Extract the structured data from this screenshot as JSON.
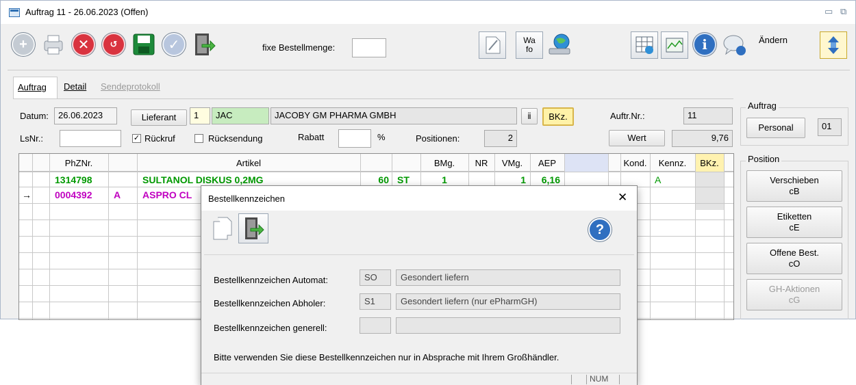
{
  "window": {
    "title": "Auftrag 11 - 26.06.2023 (Offen)",
    "minimize_glyph": "▭",
    "restore_glyph": "⧉"
  },
  "toolbar": {
    "fixe_bestellmenge_label": "fixe Bestellmenge:",
    "fixe_bestellmenge_value": "",
    "wafo_line1": "Wa",
    "wafo_line2": "fo",
    "aendern_label": "Ändern"
  },
  "tabs": [
    {
      "label": "Auftrag",
      "active": true
    },
    {
      "label": "Detail",
      "active": false
    },
    {
      "label": "Sendeprotokoll",
      "active": false,
      "disabled": true
    }
  ],
  "form": {
    "datum_label": "Datum:",
    "datum_value": "26.06.2023",
    "lieferant_button": "Lieferant",
    "lieferant_nr": "1",
    "lieferant_code": "JAC",
    "lieferant_name": "JACOBY GM PHARMA GMBH",
    "bkz_button": "BKz.",
    "auftr_nr_label": "Auftr.Nr.:",
    "auftr_nr_value": "11",
    "lsnr_label": "LsNr.:",
    "lsnr_value": "",
    "rueckruf_label": "Rückruf",
    "rueckruf_checked": true,
    "ruecksendung_label": "Rücksendung",
    "ruecksendung_checked": false,
    "rabatt_label": "Rabatt",
    "rabatt_value": "",
    "percent": "%",
    "positionen_label": "Positionen:",
    "positionen_value": "2",
    "wert_button": "Wert",
    "wert_value": "9,76"
  },
  "auftrag_group": {
    "title": "Auftrag",
    "personal_button": "Personal",
    "personal_value": "01"
  },
  "position_group": {
    "title": "Position",
    "buttons": [
      {
        "line1": "Verschieben",
        "line2": "cB",
        "disabled": false
      },
      {
        "line1": "Etiketten",
        "line2": "cE",
        "disabled": false
      },
      {
        "line1": "Offene Best.",
        "line2": "cO",
        "disabled": false
      },
      {
        "line1": "GH-Aktionen",
        "line2": "cG",
        "disabled": true
      }
    ]
  },
  "grid": {
    "headers": [
      "PhZNr.",
      "Artikel",
      "BMg.",
      "NR",
      "VMg.",
      "AEP",
      "Kond.",
      "Kennz.",
      "BKz."
    ],
    "rows": [
      {
        "indicator": "",
        "phznr": "1314798",
        "flag": "",
        "artikel": "SULTANOL DISKUS 0,2MG",
        "menge": "60",
        "einheit": "ST",
        "bmg": "1",
        "nr": "",
        "vmg": "1",
        "aep": "6,16",
        "kond": "",
        "kennz": "A",
        "color": "#009900"
      },
      {
        "indicator": "→",
        "phznr": "0004392",
        "flag": "A",
        "artikel": "ASPRO CL",
        "menge": "",
        "einheit": "",
        "bmg": "",
        "nr": "",
        "vmg": "",
        "aep": "",
        "kond": "",
        "kennz": "",
        "color": "#c000c0"
      }
    ]
  },
  "dialog": {
    "title": "Bestellkennzeichen",
    "close_glyph": "✕",
    "rows": [
      {
        "label": "Bestellkennzeichen Automat:",
        "code": "SO",
        "text": "Gesondert liefern"
      },
      {
        "label": "Bestellkennzeichen Abholer:",
        "code": "S1",
        "text": "Gesondert liefern (nur ePharmGH)"
      },
      {
        "label": "Bestellkennzeichen generell:",
        "code": "",
        "text": ""
      }
    ],
    "hint": "Bitte verwenden Sie diese Bestellkennzeichen nur in Absprache mit Ihrem Großhändler.",
    "status_num": "NUM"
  },
  "colors": {
    "green_text": "#009900",
    "magenta_text": "#c000c0",
    "lieferant_code_bg": "#c7ecbf",
    "bkz_highlight": "#fff2a8",
    "aep_header_bg": "#dde3f5",
    "bkz_header_bg": "#fff2b0"
  }
}
